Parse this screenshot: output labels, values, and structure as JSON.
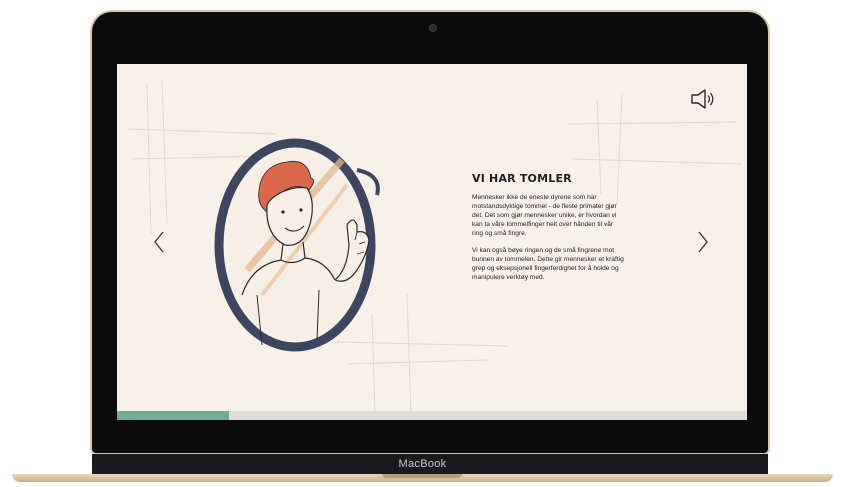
{
  "device": {
    "brand": "MacBook"
  },
  "slide": {
    "title": "VI HAR TOMLER",
    "paragraphs": [
      "Mennesker ikke de eneste dyrene som har motstandsdyktige tommel - de fleste primater gjør det. Det som gjør mennesker unike, er hvordan vi kan ta våre tommelfinger helt over hånden til vår ring og små fingre.",
      "Vi kan også bøye ringen og de små fingrene mot bunnen av tommelen. Dette gir mennesker et kraftig grep og eksepsjonell fingerferdighet for å holde og manipulere verktøy med."
    ]
  },
  "controls": {
    "sound_icon": "speaker-icon",
    "prev_icon": "chevron-left-icon",
    "next_icon": "chevron-right-icon"
  },
  "progress": {
    "value": 0.178
  },
  "colors": {
    "screen_background": "#f8f1e9",
    "progress_fill": "#74ad92",
    "progress_track": "#e1ddd7",
    "mirror_frame": "#3e4560",
    "hair": "#d9694a",
    "glint": "#e5b98a"
  }
}
